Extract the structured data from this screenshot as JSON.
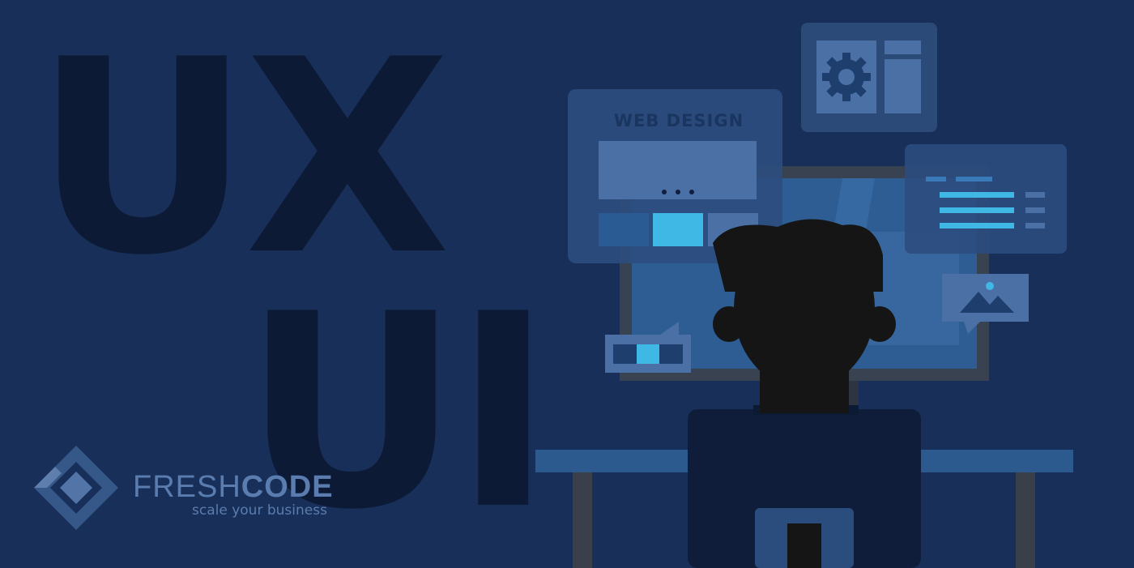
{
  "headline": {
    "ux": "UX",
    "ui": "UI"
  },
  "panel": {
    "title": "WEB DESIGN"
  },
  "logo": {
    "brand_light": "FRESH",
    "brand_bold": "CODE",
    "tagline": "scale your business"
  },
  "colors": {
    "background": "#183059",
    "big_letters": "#0d1a36",
    "accent": "#3fb8e6",
    "panel": "#4a6fa5",
    "silhouette": "#151515"
  },
  "icons": [
    "gear-icon",
    "image-icon",
    "speech-bubble-icon",
    "logo-mark-icon"
  ]
}
